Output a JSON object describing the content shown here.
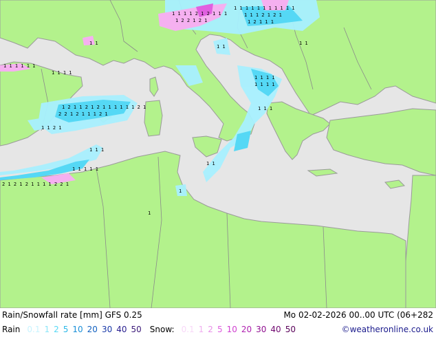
{
  "map": {
    "colors": {
      "sea": "#e6e6e6",
      "land": "#b3f28c",
      "border": "#8a8a8a",
      "coast": "#9a9a9a",
      "rain_light": "#a8f0ff",
      "rain_medium": "#55d8f5",
      "rain_heavy": "#2aa8d8",
      "snow_light": "#f5b0f0",
      "snow_medium": "#e060e0",
      "symbol": "#000000"
    }
  },
  "footer": {
    "title": "Rain/Snowfall rate [mm] GFS 0.25",
    "datetime": "Mo 02-02-2026 00..00 UTC (06+282",
    "credit": "©weatheronline.co.uk",
    "rain_label": "Rain",
    "snow_label": "Snow:",
    "rain_scale": [
      {
        "text": "0.1",
        "color": "#c8f4ff"
      },
      {
        "text": "1",
        "color": "#8ce6f8"
      },
      {
        "text": "2",
        "color": "#55d8f5"
      },
      {
        "text": "5",
        "color": "#2ab8e8"
      },
      {
        "text": "10",
        "color": "#1a90d8"
      },
      {
        "text": "20",
        "color": "#1060c0"
      },
      {
        "text": "30",
        "color": "#1838a8"
      },
      {
        "text": "40",
        "color": "#2a2090"
      },
      {
        "text": "50",
        "color": "#3a1878"
      }
    ],
    "snow_scale": [
      {
        "text": "0.1",
        "color": "#f8d8f8"
      },
      {
        "text": "1",
        "color": "#f0b0f0"
      },
      {
        "text": "2",
        "color": "#e890e8"
      },
      {
        "text": "5",
        "color": "#e060e0"
      },
      {
        "text": "10",
        "color": "#d040d0"
      },
      {
        "text": "20",
        "color": "#b020b0"
      },
      {
        "text": "30",
        "color": "#901090"
      },
      {
        "text": "40",
        "color": "#700870"
      },
      {
        "text": "50",
        "color": "#580058"
      }
    ]
  }
}
